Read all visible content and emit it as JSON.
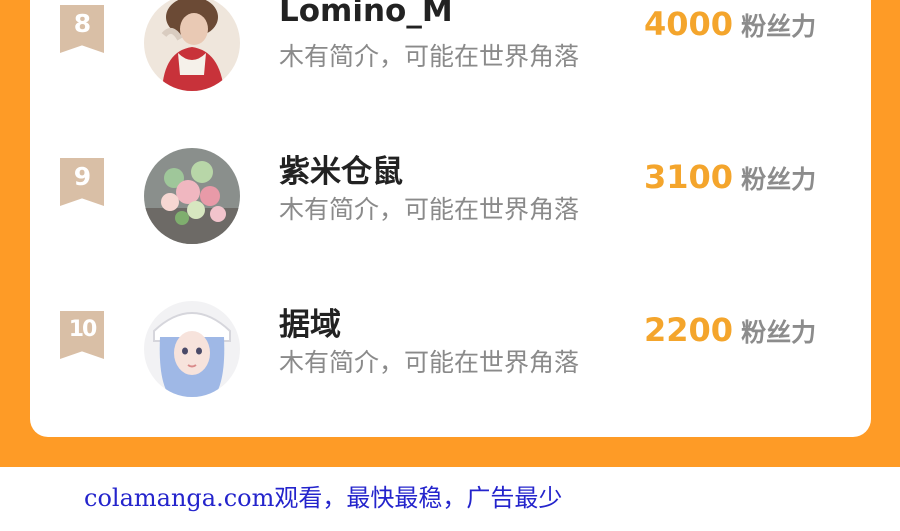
{
  "ranking": {
    "entries": [
      {
        "rank": "8",
        "name": "Lomino_M",
        "description": "木有简介，可能在世界角落",
        "fans_count": "4000",
        "fans_unit": "粉丝力"
      },
      {
        "rank": "9",
        "name": "紫米仓鼠",
        "description": "木有简介，可能在世界角落",
        "fans_count": "3100",
        "fans_unit": "粉丝力"
      },
      {
        "rank": "10",
        "name": "据域",
        "description": "木有简介，可能在世界角落",
        "fans_count": "2200",
        "fans_unit": "粉丝力"
      }
    ]
  },
  "footer": {
    "watermark": "colamanga.com观看，最快最稳，广告最少"
  },
  "colors": {
    "background_orange": "#fe9b26",
    "rank_badge": "#d9bfa6",
    "fans_count": "#f4a52c",
    "watermark": "#2424cc"
  }
}
